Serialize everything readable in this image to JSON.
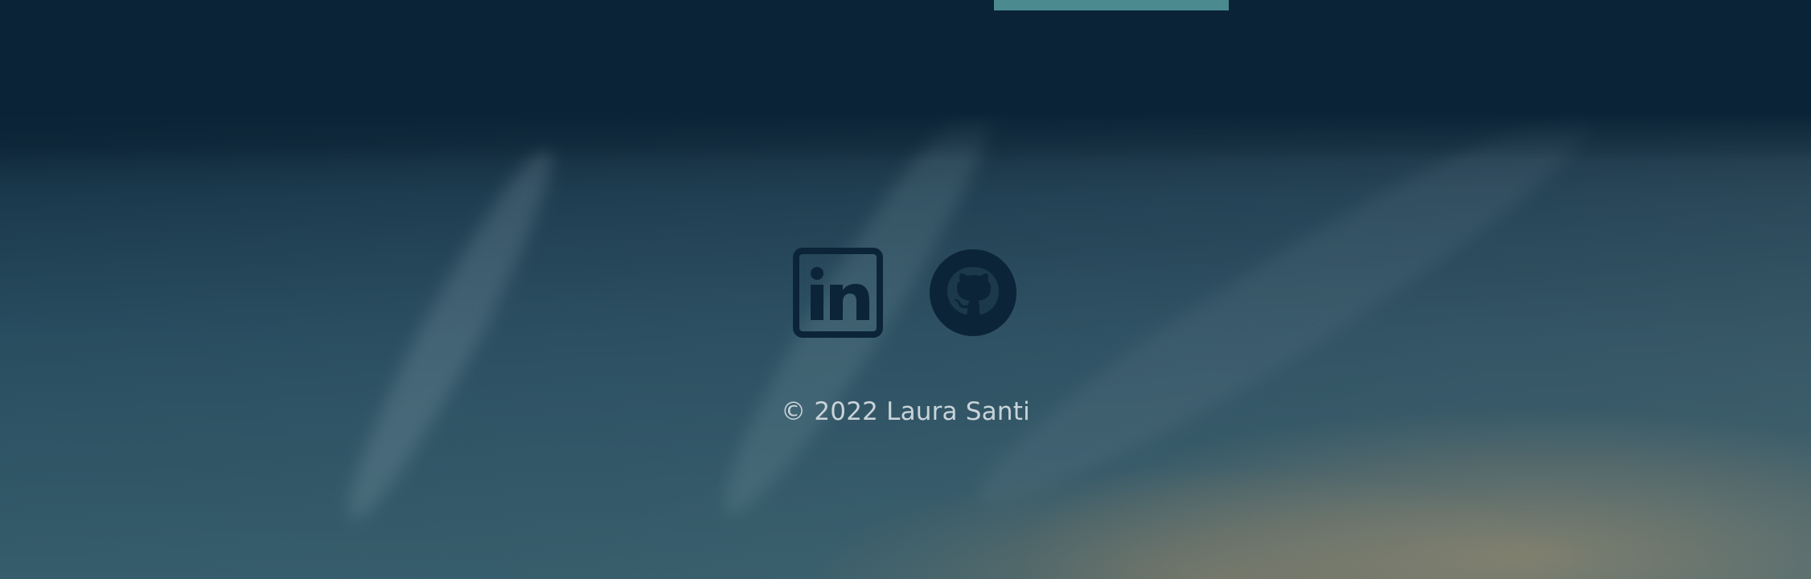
{
  "top_bar": {
    "color": "#4b8a8f"
  },
  "social": {
    "icon_color": "#0c2438",
    "links": [
      {
        "icon": "linkedin-icon"
      },
      {
        "icon": "github-icon"
      }
    ]
  },
  "footer": {
    "copyright": "© 2022 Laura Santi"
  }
}
